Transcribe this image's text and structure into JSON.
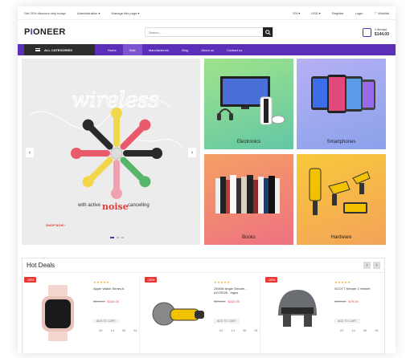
{
  "topbar": {
    "promo": "Get 20% discount only today!",
    "administration": "Administration ▾",
    "manage": "Manage this page ▾",
    "lang": "EN ▾",
    "currency": "USD ▾",
    "register": "Register",
    "login": "Login",
    "wishlist": "♡ Wishlist"
  },
  "header": {
    "logo_pre": "P",
    "logo_o": "I",
    "logo_rest": "ONEER",
    "search_placeholder": "Search...",
    "cart_items": "1 item(s)",
    "cart_total": "$144.00"
  },
  "nav": {
    "all_categories": "ALL CATEGORIES",
    "items": [
      "Home",
      "Sale",
      "Manufacturers",
      "Blog",
      "About us",
      "Contact us"
    ]
  },
  "banner": {
    "headline": "wireless",
    "tagline_pre": "with active",
    "tagline_noise": "noise",
    "tagline_post": "cancelling",
    "cta": "SHOP NOW ›"
  },
  "tiles": [
    {
      "label": "Electronics",
      "color": "#7ed88f"
    },
    {
      "label": "Smartphones",
      "color": "#9aa3f0"
    },
    {
      "label": "Books",
      "color": "#f08a6f"
    },
    {
      "label": "Hardware",
      "color": "#f7c64a"
    }
  ],
  "hot_deals": {
    "title": "Hot Deals",
    "products": [
      {
        "discount": "-28%",
        "stars": "★★★★★",
        "name": "Apple Watch Series 6",
        "old_price": "$199.00",
        "price": "$144.00",
        "add": "ADD TO CART",
        "timer": [
          "02",
          "14",
          "06",
          "51"
        ]
      },
      {
        "discount": "-26%",
        "stars": "★★★★★",
        "name": "2500W Angle Grinder - AG75028 - Ingco",
        "old_price": "$299.00",
        "price": "$222.00",
        "add": "ADD TO CART",
        "timer": [
          "02",
          "14",
          "06",
          "51"
        ]
      },
      {
        "discount": "-28%",
        "stars": "★★★★★",
        "name": "SCOTT Keeper 2 Helmet",
        "old_price": "$109.00",
        "price": "$79.00",
        "add": "ADD TO CART",
        "timer": [
          "02",
          "14",
          "06",
          "51"
        ]
      }
    ]
  },
  "colors": {
    "accent": "#5b2fb8",
    "sale": "#e53935"
  }
}
